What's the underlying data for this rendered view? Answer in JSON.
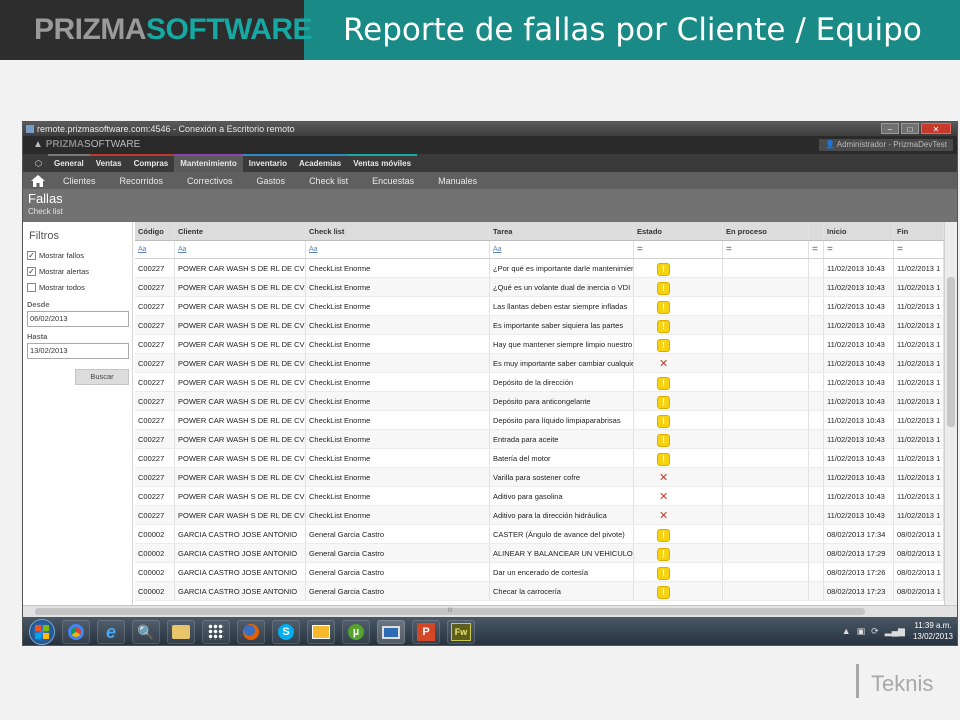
{
  "slide": {
    "logo_prefix": "PRIZMA",
    "logo_suffix": "SOFTWARE",
    "title": "Reporte de fallas  por Cliente / Equipo",
    "footer_brand": "Teknis"
  },
  "window": {
    "title": "remote.prizmasoftware.com:4546 - Conexión a Escritorio remoto"
  },
  "app": {
    "logo_prefix": "PRIZMA",
    "logo_suffix": "SOFTWARE",
    "user": "Administrador - PrizmaDevTest",
    "menu": [
      "General",
      "Ventas",
      "Compras",
      "Mantenimiento",
      "Inventario",
      "Academias",
      "Ventas móviles"
    ],
    "menu_active": "Mantenimiento",
    "subnav": [
      "Clientes",
      "Recorridos",
      "Correctivos",
      "Gastos",
      "Check list",
      "Encuestas",
      "Manuales"
    ],
    "section_title": "Fallas",
    "section_subtitle": "Check list"
  },
  "filters": {
    "title": "Filtros",
    "checkboxes": [
      {
        "label": "Mostrar fallos",
        "checked": true
      },
      {
        "label": "Mostrar alertas",
        "checked": true
      },
      {
        "label": "Mostrar todos",
        "checked": false
      }
    ],
    "desde_label": "Desde",
    "desde_value": "06/02/2013",
    "hasta_label": "Hasta",
    "hasta_value": "13/02/2013",
    "buscar_label": "Buscar"
  },
  "grid": {
    "columns": [
      "Código",
      "Cliente",
      "Check list",
      "Tarea",
      "Estado",
      "En proceso",
      "",
      "Inicio",
      "Fin"
    ],
    "filter_text": "Aa",
    "filter_eq": "=",
    "rows": [
      {
        "codigo": "C00227",
        "cliente": "POWER CAR WASH S DE RL  DE CV",
        "checklist": "CheckList Enorme",
        "tarea": "¿Por qué es importante darle mantenimiento",
        "estado": "warning",
        "inicio": "11/02/2013 10:43",
        "fin": "11/02/2013 1"
      },
      {
        "codigo": "C00227",
        "cliente": "POWER CAR WASH S DE RL  DE CV",
        "checklist": "CheckList Enorme",
        "tarea": "¿Qué es un volante dual de inercia o VDI",
        "estado": "warning",
        "inicio": "11/02/2013 10:43",
        "fin": "11/02/2013 1"
      },
      {
        "codigo": "C00227",
        "cliente": "POWER CAR WASH S DE RL  DE CV",
        "checklist": "CheckList Enorme",
        "tarea": "Las llantas deben estar siempre infladas",
        "estado": "warning",
        "inicio": "11/02/2013 10:43",
        "fin": "11/02/2013 1"
      },
      {
        "codigo": "C00227",
        "cliente": "POWER CAR WASH S DE RL  DE CV",
        "checklist": "CheckList Enorme",
        "tarea": "Es importante saber siquiera las partes",
        "estado": "warning",
        "inicio": "11/02/2013 10:43",
        "fin": "11/02/2013 1"
      },
      {
        "codigo": "C00227",
        "cliente": "POWER CAR WASH S DE RL  DE CV",
        "checklist": "CheckList Enorme",
        "tarea": "Hay que mantener siempre limpio nuestro",
        "estado": "warning",
        "inicio": "11/02/2013 10:43",
        "fin": "11/02/2013 1"
      },
      {
        "codigo": "C00227",
        "cliente": "POWER CAR WASH S DE RL  DE CV",
        "checklist": "CheckList Enorme",
        "tarea": "Es muy importante saber cambiar cualquier",
        "estado": "error",
        "inicio": "11/02/2013 10:43",
        "fin": "11/02/2013 1"
      },
      {
        "codigo": "C00227",
        "cliente": "POWER CAR WASH S DE RL  DE CV",
        "checklist": "CheckList Enorme",
        "tarea": "Depósito de la dirección",
        "estado": "warning",
        "inicio": "11/02/2013 10:43",
        "fin": "11/02/2013 1"
      },
      {
        "codigo": "C00227",
        "cliente": "POWER CAR WASH S DE RL  DE CV",
        "checklist": "CheckList Enorme",
        "tarea": "Depósito para anticongelante",
        "estado": "warning",
        "inicio": "11/02/2013 10:43",
        "fin": "11/02/2013 1"
      },
      {
        "codigo": "C00227",
        "cliente": "POWER CAR WASH S DE RL  DE CV",
        "checklist": "CheckList Enorme",
        "tarea": "Depósito para líquido limpiaparabrisas",
        "estado": "warning",
        "inicio": "11/02/2013 10:43",
        "fin": "11/02/2013 1"
      },
      {
        "codigo": "C00227",
        "cliente": "POWER CAR WASH S DE RL  DE CV",
        "checklist": "CheckList Enorme",
        "tarea": "Entrada para aceite",
        "estado": "warning",
        "inicio": "11/02/2013 10:43",
        "fin": "11/02/2013 1"
      },
      {
        "codigo": "C00227",
        "cliente": "POWER CAR WASH S DE RL  DE CV",
        "checklist": "CheckList Enorme",
        "tarea": "Batería del motor",
        "estado": "warning",
        "inicio": "11/02/2013 10:43",
        "fin": "11/02/2013 1"
      },
      {
        "codigo": "C00227",
        "cliente": "POWER CAR WASH S DE RL  DE CV",
        "checklist": "CheckList Enorme",
        "tarea": "Varilla para sostener cofre",
        "estado": "error",
        "inicio": "11/02/2013 10:43",
        "fin": "11/02/2013 1"
      },
      {
        "codigo": "C00227",
        "cliente": "POWER CAR WASH S DE RL  DE CV",
        "checklist": "CheckList Enorme",
        "tarea": "Aditivo para gasolina",
        "estado": "error",
        "inicio": "11/02/2013 10:43",
        "fin": "11/02/2013 1"
      },
      {
        "codigo": "C00227",
        "cliente": "POWER CAR WASH S DE RL  DE CV",
        "checklist": "CheckList Enorme",
        "tarea": "Aditivo para la dirección hidráulica",
        "estado": "error",
        "inicio": "11/02/2013 10:43",
        "fin": "11/02/2013 1"
      },
      {
        "codigo": "C00002",
        "cliente": "GARCIA CASTRO JOSE ANTONIO",
        "checklist": "General Garcia Castro",
        "tarea": "CASTER (Ángulo de avance del pivote)",
        "estado": "warning",
        "inicio": "08/02/2013 17:34",
        "fin": "08/02/2013 1"
      },
      {
        "codigo": "C00002",
        "cliente": "GARCIA CASTRO JOSE ANTONIO",
        "checklist": "General Garcia Castro",
        "tarea": "ALINEAR Y BALANCEAR UN VEHICULO",
        "estado": "warning",
        "inicio": "08/02/2013 17:29",
        "fin": "08/02/2013 1"
      },
      {
        "codigo": "C00002",
        "cliente": "GARCIA CASTRO JOSE ANTONIO",
        "checklist": "General Garcia Castro",
        "tarea": "Dar un encerado de cortesía",
        "estado": "warning",
        "inicio": "08/02/2013 17:26",
        "fin": "08/02/2013 1"
      },
      {
        "codigo": "C00002",
        "cliente": "GARCIA CASTRO JOSE ANTONIO",
        "checklist": "General Garcia Castro",
        "tarea": "Checar la carrocería",
        "estado": "warning",
        "inicio": "08/02/2013 17:23",
        "fin": "08/02/2013 1"
      }
    ],
    "hscroll_grip": "III"
  },
  "taskbar": {
    "apps": [
      "start",
      "chrome",
      "internet-explorer",
      "search",
      "file-explorer",
      "network",
      "firefox",
      "skype",
      "outlook",
      "utorrent",
      "remote-desktop",
      "powerpoint",
      "fireworks"
    ],
    "time": "11:39 a.m.",
    "date": "13/02/2013"
  }
}
